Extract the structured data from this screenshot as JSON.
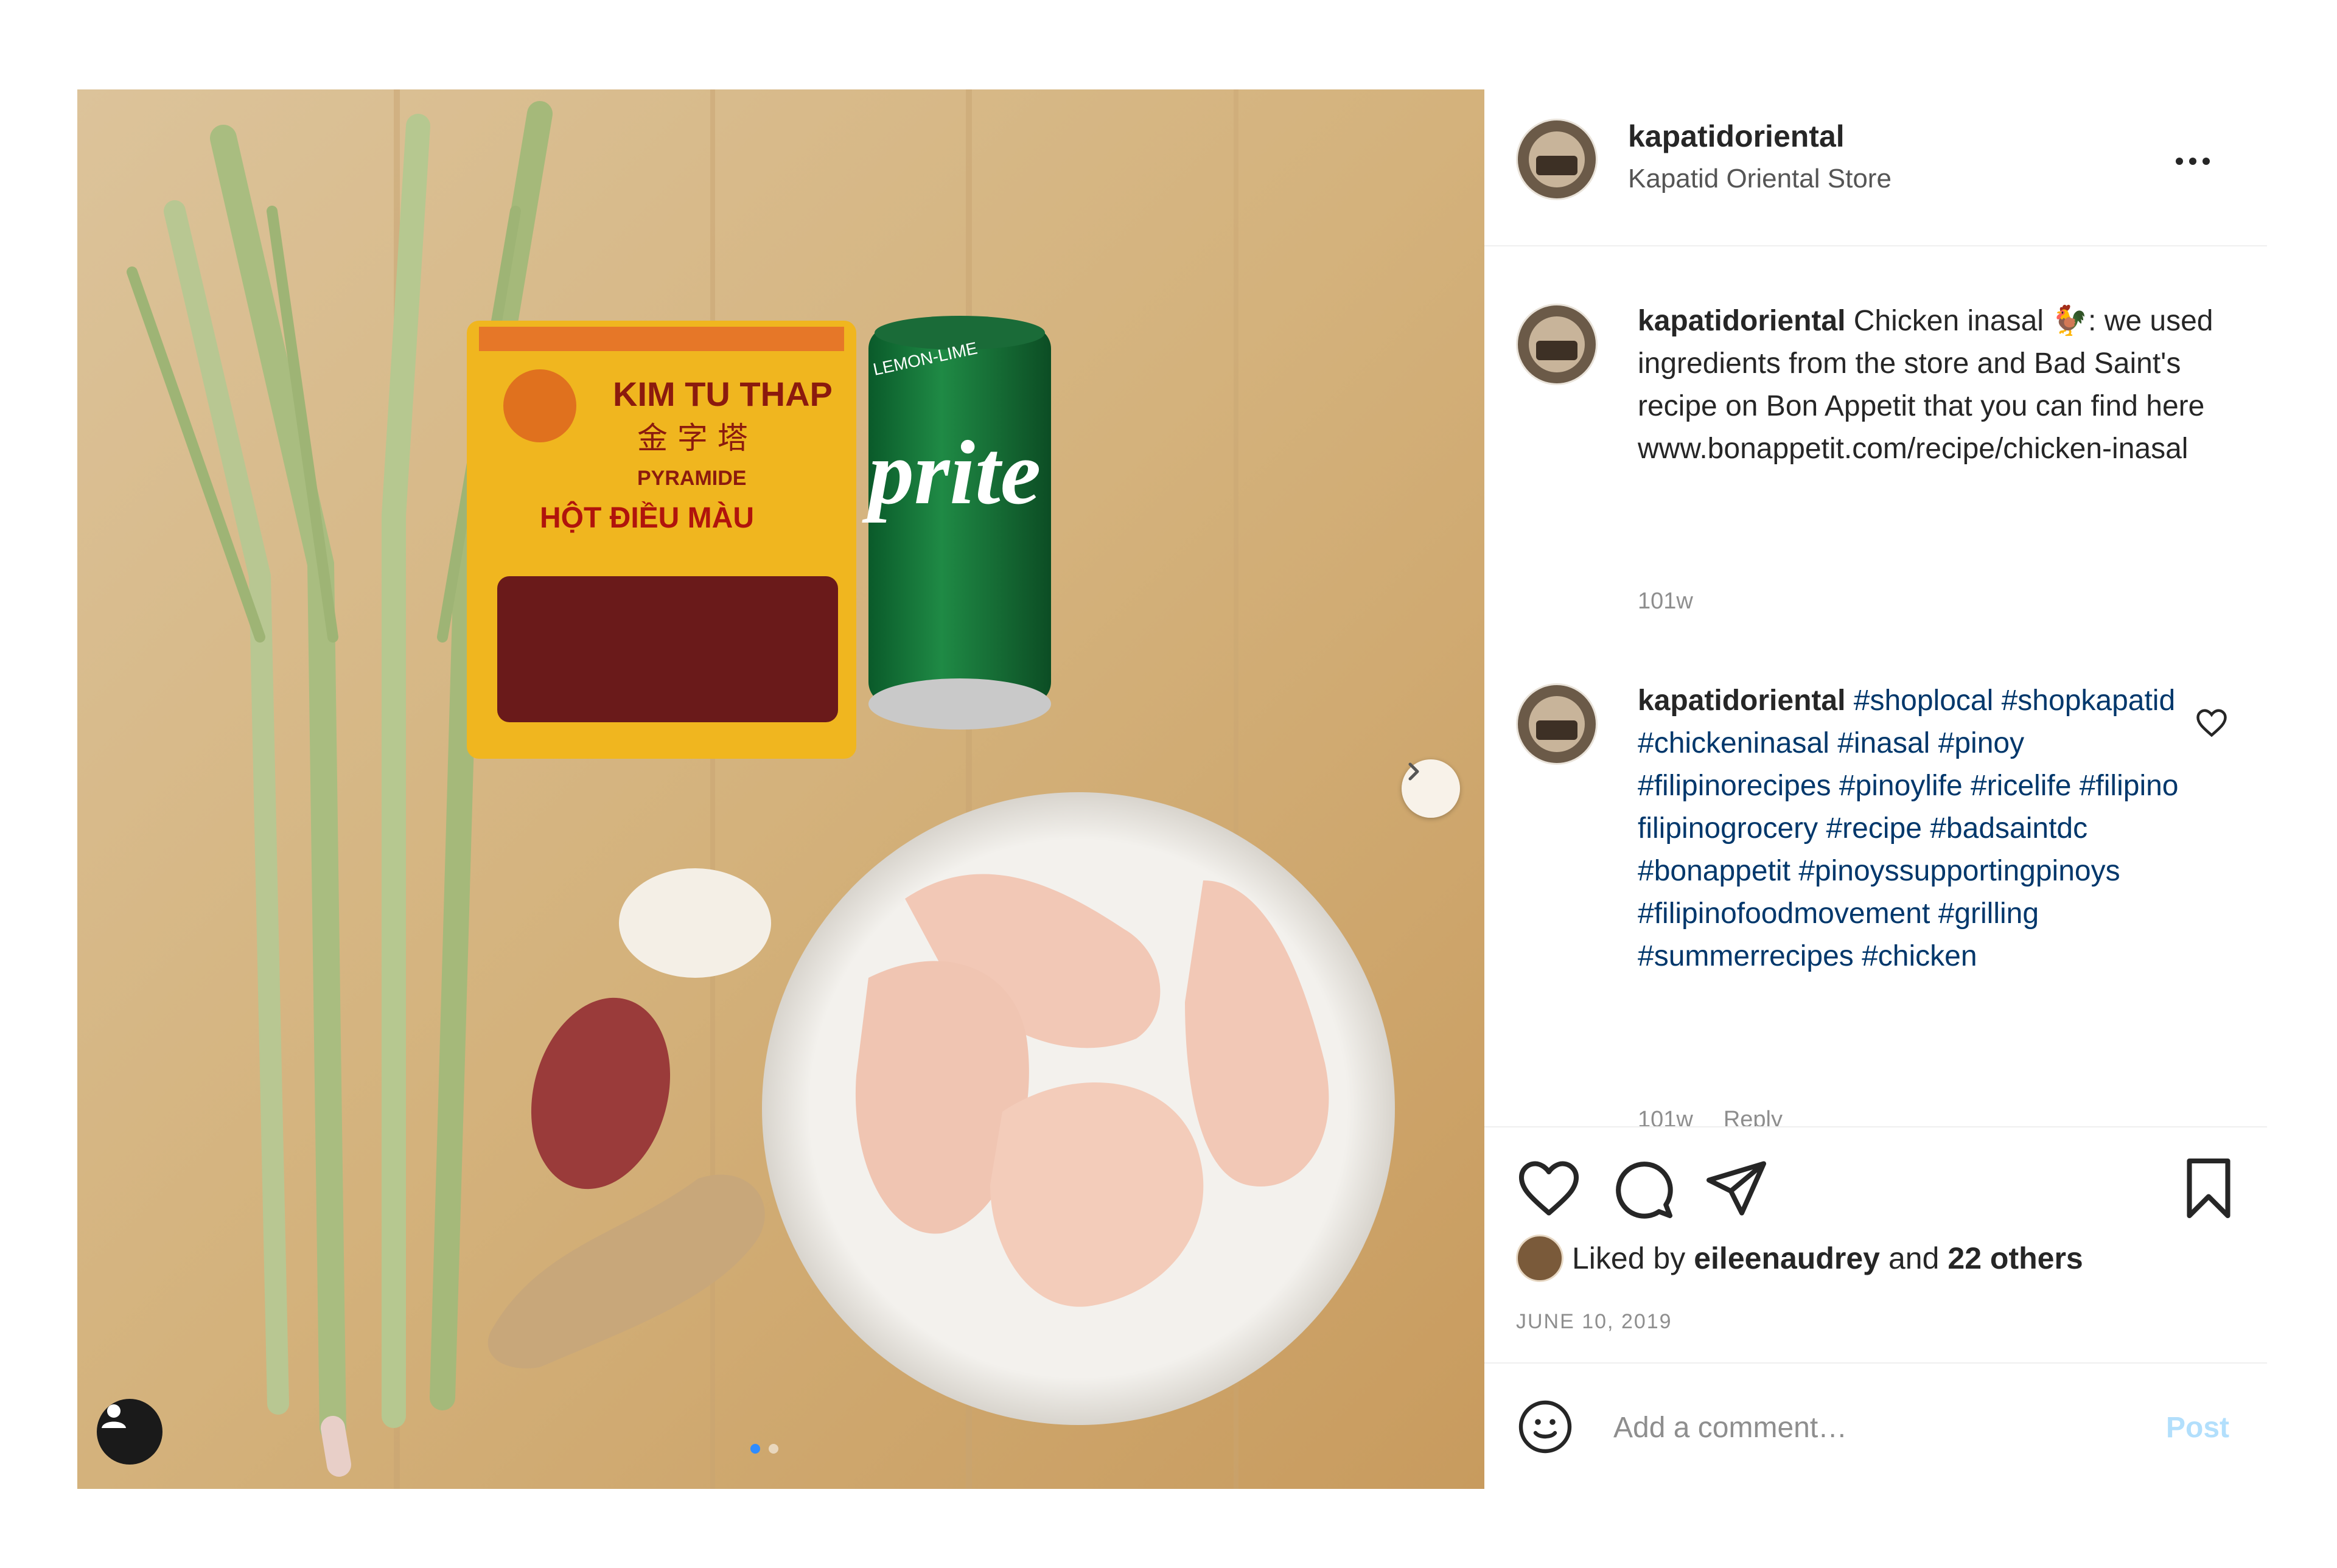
{
  "account": {
    "username": "kapatidoriental",
    "display_name": "Kapatid Oriental Store"
  },
  "caption": {
    "username": "kapatidoriental",
    "text": "Chicken inasal 🐓: we used ingredients from the store and Bad Saint's recipe on Bon Appetit that you can find here www.bonappetit.com/recipe/chicken-inasal",
    "time": "101w"
  },
  "comment": {
    "username": "kapatidoriental",
    "hashtags": "#shoplocal #shopkapatid #chickeninasal #inasal #pinoy #filipinorecipes #pinoylife #ricelife #filipino filipinogrocery #recipe #badsaintdc #bonappetit #pinoyssupportingpinoys #filipinofoodmovement #grilling #summerrecipes #chicken",
    "time": "101w",
    "reply_label": "Reply"
  },
  "likes": {
    "prefix": "Liked by",
    "user": "eileenaudrey",
    "connector": "and",
    "others": "22 others"
  },
  "date": "JUNE 10, 2019",
  "comment_box": {
    "placeholder": "Add a comment…",
    "post_label": "Post"
  },
  "photo": {
    "package_title": "KIM TU THAP",
    "package_chinese": "金 字 塔",
    "package_brand": "PYRAMIDE",
    "package_product": "HỘT ĐIỀU MÀU",
    "can_flavor": "LEMON-LIME",
    "can_brand": "prite"
  },
  "carousel": {
    "total": 2,
    "current": 1
  },
  "icons": [
    "more-icon",
    "heart-icon",
    "comment-icon",
    "share-icon",
    "bookmark-icon",
    "emoji-icon",
    "next-arrow-icon",
    "user-tag-icon"
  ],
  "colors": {
    "link": "#00376b",
    "post_disabled": "#b2dffc",
    "muted": "#8e8e8e",
    "carousel_active": "#2f8cff"
  }
}
